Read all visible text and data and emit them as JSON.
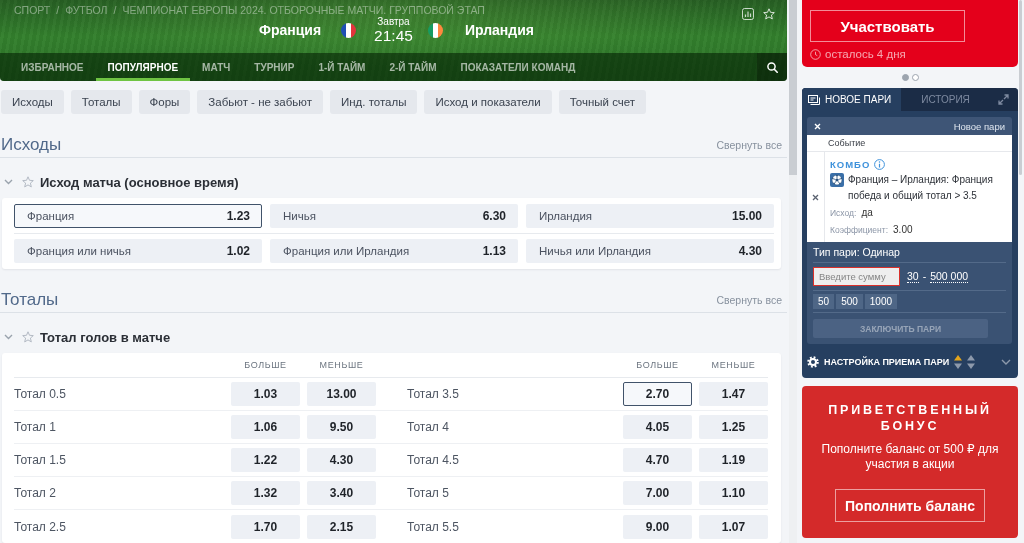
{
  "header": {
    "breadcrumb": [
      {
        "kind": "link",
        "text": "СПОРТ"
      },
      {
        "kind": "separator",
        "text": "/"
      },
      {
        "kind": "link",
        "text": "ФУТБОЛ"
      },
      {
        "kind": "separator",
        "text": "/"
      },
      {
        "kind": "link",
        "text": "ЧЕМПИОНАТ ЕВРОПЫ 2024. ОТБОРОЧНЫЕ МАТЧИ. ГРУППОВОЙ ЭТАП"
      }
    ],
    "home_team": "Франция",
    "away_team": "Ирландия",
    "day": "Завтра",
    "time": "21:45"
  },
  "tabs": [
    {
      "label": "ИЗБРАННОЕ",
      "selected": false
    },
    {
      "label": "ПОПУЛЯРНОЕ",
      "selected": true
    },
    {
      "label": "МАТЧ",
      "selected": false
    },
    {
      "label": "ТУРНИР",
      "selected": false
    },
    {
      "label": "1-Й ТАЙМ",
      "selected": false
    },
    {
      "label": "2-Й ТАЙМ",
      "selected": false
    },
    {
      "label": "ПОКАЗАТЕЛИ КОМАНД",
      "selected": false
    }
  ],
  "filters": [
    "Исходы",
    "Тоталы",
    "Форы",
    "Забьют - не забьют",
    "Инд. тоталы",
    "Исход и показатели",
    "Точный счет"
  ],
  "sections": [
    {
      "title": "Исходы",
      "collapse_label": "Свернуть все",
      "market": {
        "kind": "grid",
        "title": "Исход матча (основное время)",
        "expanded": true,
        "starred": false,
        "rows": [
          [
            {
              "label": "Франция",
              "odds": "1.23",
              "selected": true
            },
            {
              "label": "Ничья",
              "odds": "6.30",
              "selected": false
            },
            {
              "label": "Ирландия",
              "odds": "15.00",
              "selected": false
            }
          ],
          [
            {
              "label": "Франция или ничья",
              "odds": "1.02",
              "selected": false
            },
            {
              "label": "Франция или Ирландия",
              "odds": "1.13",
              "selected": false
            },
            {
              "label": "Ничья или Ирландия",
              "odds": "4.30",
              "selected": false
            }
          ]
        ]
      }
    },
    {
      "title": "Тоталы",
      "collapse_label": "Свернуть все",
      "market": {
        "kind": "totals",
        "title": "Тотал голов в матче",
        "expanded": true,
        "starred": false,
        "columns": [
          "БОЛЬШЕ",
          "МЕНЬШЕ",
          "БОЛЬШЕ",
          "МЕНЬШЕ"
        ],
        "rows": [
          {
            "sides": [
              {
                "label": "Тотал 0.5",
                "odds": [
                  {
                    "value": "1.03",
                    "selected": false
                  },
                  {
                    "value": "13.00",
                    "selected": false
                  }
                ]
              },
              {
                "label": "Тотал 3.5",
                "odds": [
                  {
                    "value": "2.70",
                    "selected": true
                  },
                  {
                    "value": "1.47",
                    "selected": false
                  }
                ]
              }
            ]
          },
          {
            "sides": [
              {
                "label": "Тотал 1",
                "odds": [
                  {
                    "value": "1.06",
                    "selected": false
                  },
                  {
                    "value": "9.50",
                    "selected": false
                  }
                ]
              },
              {
                "label": "Тотал 4",
                "odds": [
                  {
                    "value": "4.05",
                    "selected": false
                  },
                  {
                    "value": "1.25",
                    "selected": false
                  }
                ]
              }
            ]
          },
          {
            "sides": [
              {
                "label": "Тотал 1.5",
                "odds": [
                  {
                    "value": "1.22",
                    "selected": false
                  },
                  {
                    "value": "4.30",
                    "selected": false
                  }
                ]
              },
              {
                "label": "Тотал 4.5",
                "odds": [
                  {
                    "value": "4.70",
                    "selected": false
                  },
                  {
                    "value": "1.19",
                    "selected": false
                  }
                ]
              }
            ]
          },
          {
            "sides": [
              {
                "label": "Тотал 2",
                "odds": [
                  {
                    "value": "1.32",
                    "selected": false
                  },
                  {
                    "value": "3.40",
                    "selected": false
                  }
                ]
              },
              {
                "label": "Тотал 5",
                "odds": [
                  {
                    "value": "7.00",
                    "selected": false
                  },
                  {
                    "value": "1.10",
                    "selected": false
                  }
                ]
              }
            ]
          },
          {
            "sides": [
              {
                "label": "Тотал 2.5",
                "odds": [
                  {
                    "value": "1.70",
                    "selected": false
                  },
                  {
                    "value": "2.15",
                    "selected": false
                  }
                ]
              },
              {
                "label": "Тотал 5.5",
                "odds": [
                  {
                    "value": "9.00",
                    "selected": false
                  },
                  {
                    "value": "1.07",
                    "selected": false
                  }
                ]
              }
            ]
          }
        ]
      }
    }
  ],
  "promo": {
    "button": "Участвовать",
    "remaining": "осталось 4 дня"
  },
  "carousel": [
    {
      "selected": true
    },
    {
      "selected": false
    }
  ],
  "bet_slip": {
    "tabs": [
      {
        "label": "НОВОЕ ПАРИ",
        "selected": true
      },
      {
        "label": "ИСТОРИЯ",
        "selected": false
      }
    ],
    "title": "Новое пари",
    "column": "Событие",
    "bet": {
      "type": "КОМБО",
      "event": "Франция – Ирландия: Франция победа и общий тотал > 3.5",
      "outcome_label": "Исход:",
      "outcome": "да",
      "odds_label": "Коэффициент:",
      "odds": "3.00"
    },
    "bet_type": "Тип пари: Одинар",
    "stake": {
      "placeholder": "Введите сумму",
      "invalid": true
    },
    "limits": {
      "min": "30",
      "separator": "-",
      "max": "500 000"
    },
    "quick_amounts": [
      "50",
      "500",
      "1000"
    ],
    "submit": {
      "label": "ЗАКЛЮЧИТЬ ПАРИ",
      "disabled": true
    },
    "settings": "НАСТРОЙКА ПРИЕМА ПАРИ"
  },
  "bonus": {
    "title": "ПРИВЕТСТВЕННЫЙ БОНУС",
    "text": "Пополните баланс от 500 ₽ для участия в акции",
    "button": "Пополнить баланс"
  }
}
